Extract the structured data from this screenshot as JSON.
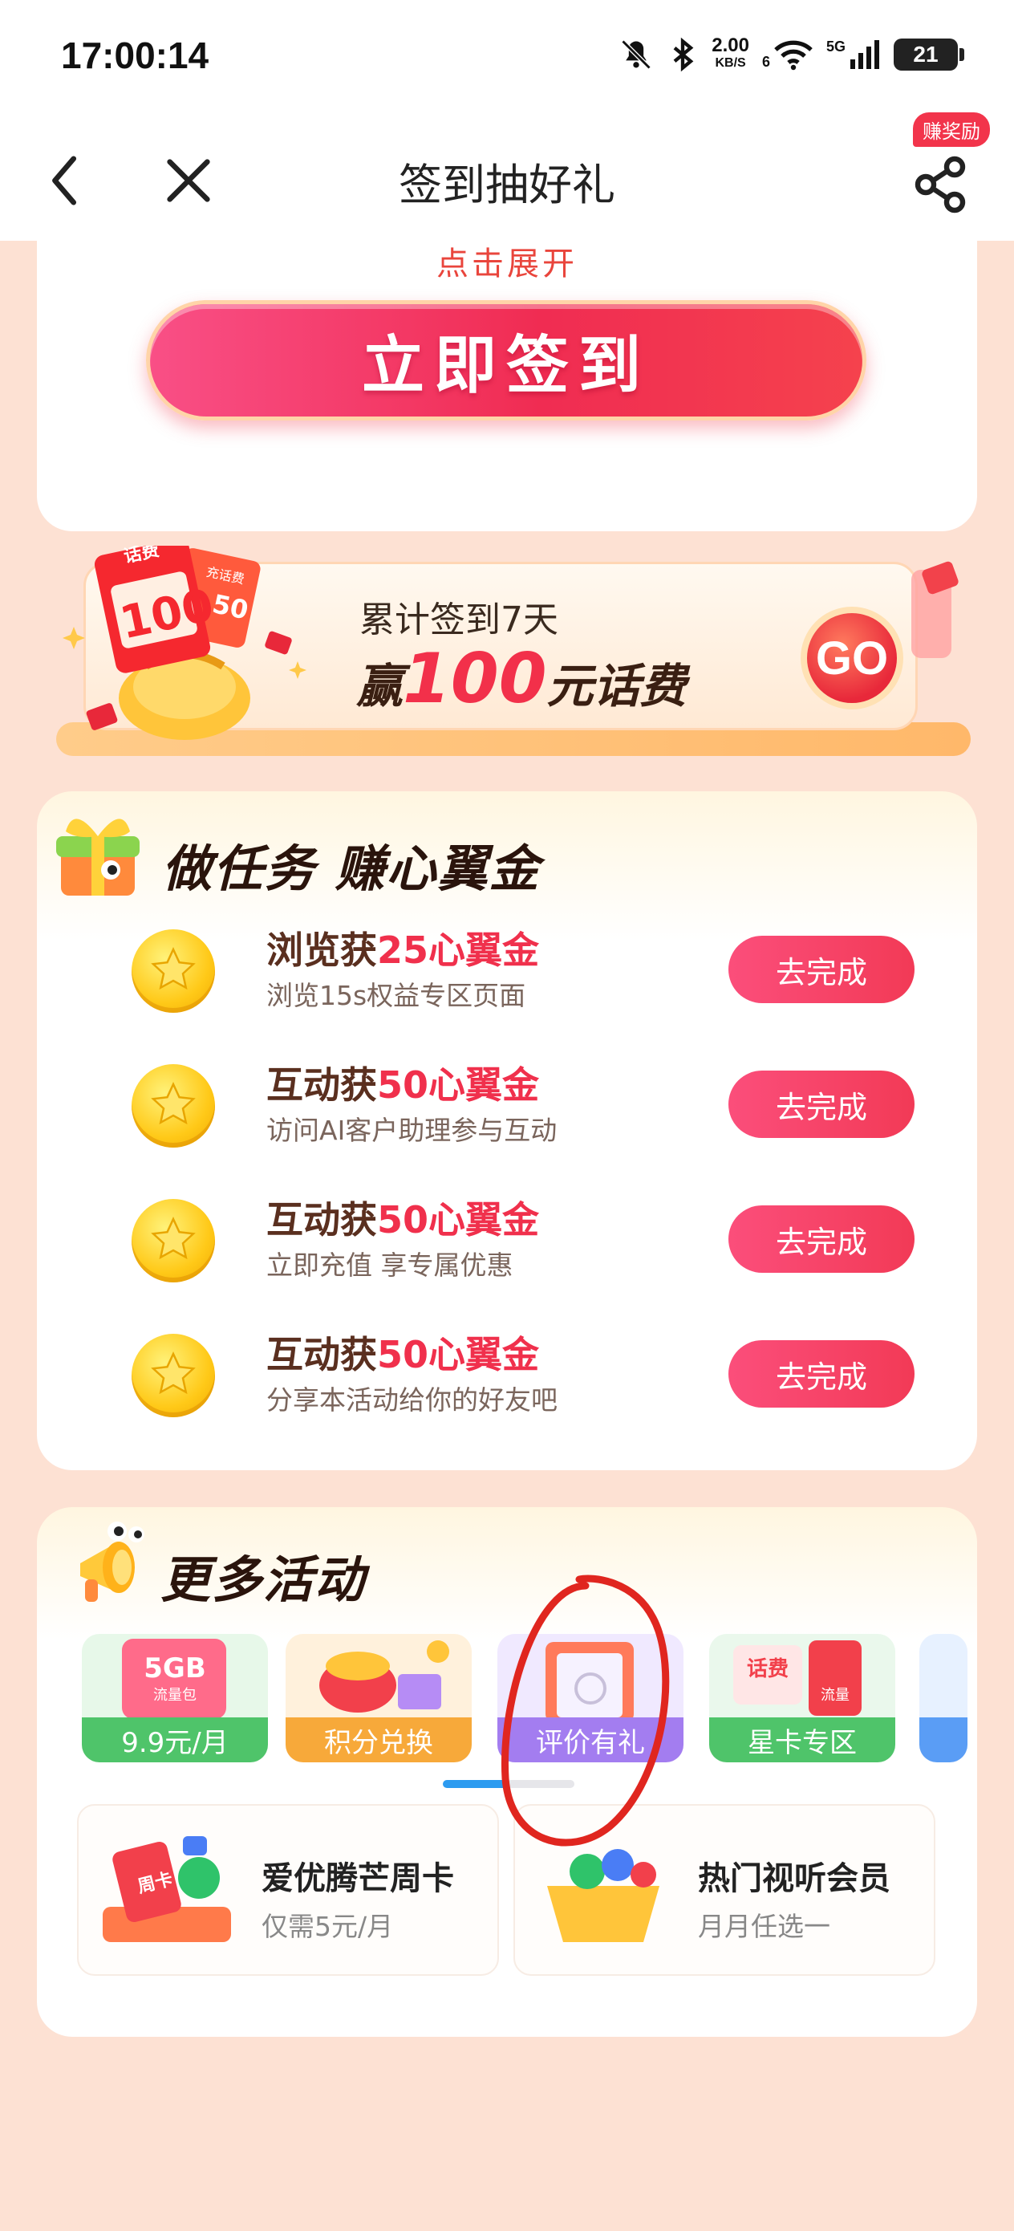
{
  "status_bar": {
    "time": "17:00:14",
    "net_speed_value": "2.00",
    "net_speed_unit": "KB/S",
    "wifi_sub": "6",
    "network": "5G",
    "battery": "21"
  },
  "nav": {
    "title": "签到抽好礼",
    "reward_badge": "赚奖励",
    "icons": [
      "back-icon",
      "close-icon",
      "share-icon"
    ]
  },
  "signin": {
    "expand_text": "点击展开",
    "button_label": "立即签到"
  },
  "banner": {
    "badge1": "话费",
    "badge1_amount": "100",
    "badge2": "充话费",
    "badge2_amount": "50",
    "line1": "累计签到7天",
    "line2_prefix": "赢",
    "line2_amount": "100",
    "line2_suffix": "元话费",
    "go_label": "GO"
  },
  "tasks": {
    "title": "做任务 赚心翼金",
    "items": [
      {
        "prefix": "浏览获",
        "amount": "25心翼金",
        "desc": "浏览15s权益专区页面",
        "button": "去完成"
      },
      {
        "prefix": "互动获",
        "amount": "50心翼金",
        "desc": "访问AI客户助理参与互动",
        "button": "去完成"
      },
      {
        "prefix": "互动获",
        "amount": "50心翼金",
        "desc": "立即充值 享专属优惠",
        "button": "去完成"
      },
      {
        "prefix": "互动获",
        "amount": "50心翼金",
        "desc": "分享本活动给你的好友吧",
        "button": "去完成"
      }
    ]
  },
  "more": {
    "title": "更多活动",
    "tiles": [
      {
        "label": "9.9元/月",
        "pic_text": "5GB",
        "pic_sub": "流量包",
        "color": "#4fc46a"
      },
      {
        "label": "积分兑换",
        "color": "#f7a93a"
      },
      {
        "label": "评价有礼",
        "color": "#a37df0"
      },
      {
        "label": "星卡专区",
        "color": "#4fc46a",
        "pic_text": "话费",
        "pic_sub": "流量"
      }
    ],
    "promos": [
      {
        "title": "爱优腾芒周卡",
        "sub": "仅需5元/月",
        "pic_text": "周卡"
      },
      {
        "title": "热门视听会员",
        "sub": "月月任选一"
      }
    ]
  }
}
